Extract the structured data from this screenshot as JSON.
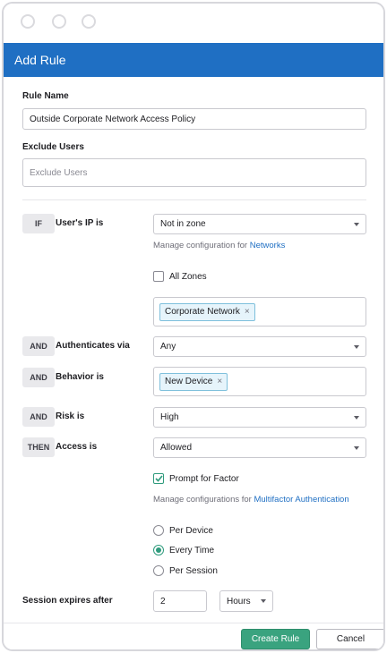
{
  "header": {
    "title": "Add Rule"
  },
  "rule_name": {
    "label": "Rule Name",
    "value": "Outside Corporate Network Access Policy"
  },
  "exclude_users": {
    "label": "Exclude Users",
    "placeholder": "Exclude Users"
  },
  "conditions": {
    "ip": {
      "keyword": "IF",
      "label": "User's IP is",
      "value": "Not in zone",
      "manage_text": "Manage configuration for ",
      "manage_link": "Networks",
      "all_zones_label": "All Zones",
      "zone_tag": "Corporate Network"
    },
    "auth": {
      "keyword": "AND",
      "label": "Authenticates via",
      "value": "Any"
    },
    "behavior": {
      "keyword": "AND",
      "label": "Behavior is",
      "tag": "New Device"
    },
    "risk": {
      "keyword": "AND",
      "label": "Risk is",
      "value": "High"
    },
    "access": {
      "keyword": "THEN",
      "label": "Access is",
      "value": "Allowed",
      "prompt_label": "Prompt for Factor",
      "manage_text": "Manage configurations for ",
      "manage_link": "Multifactor Authentication",
      "options": [
        "Per Device",
        "Every Time",
        "Per Session"
      ],
      "selected": "Every Time"
    }
  },
  "session": {
    "label": "Session expires after",
    "value": "2",
    "unit": "Hours"
  },
  "footer": {
    "create_label": "Create Rule",
    "cancel_label": "Cancel"
  },
  "colors": {
    "header": "#1f6fc3",
    "primary": "#3aa37f",
    "link": "#1f6fc3",
    "check": "#2f9b7d"
  },
  "icons": {
    "remove": "×",
    "dropdown": "caret-down"
  }
}
